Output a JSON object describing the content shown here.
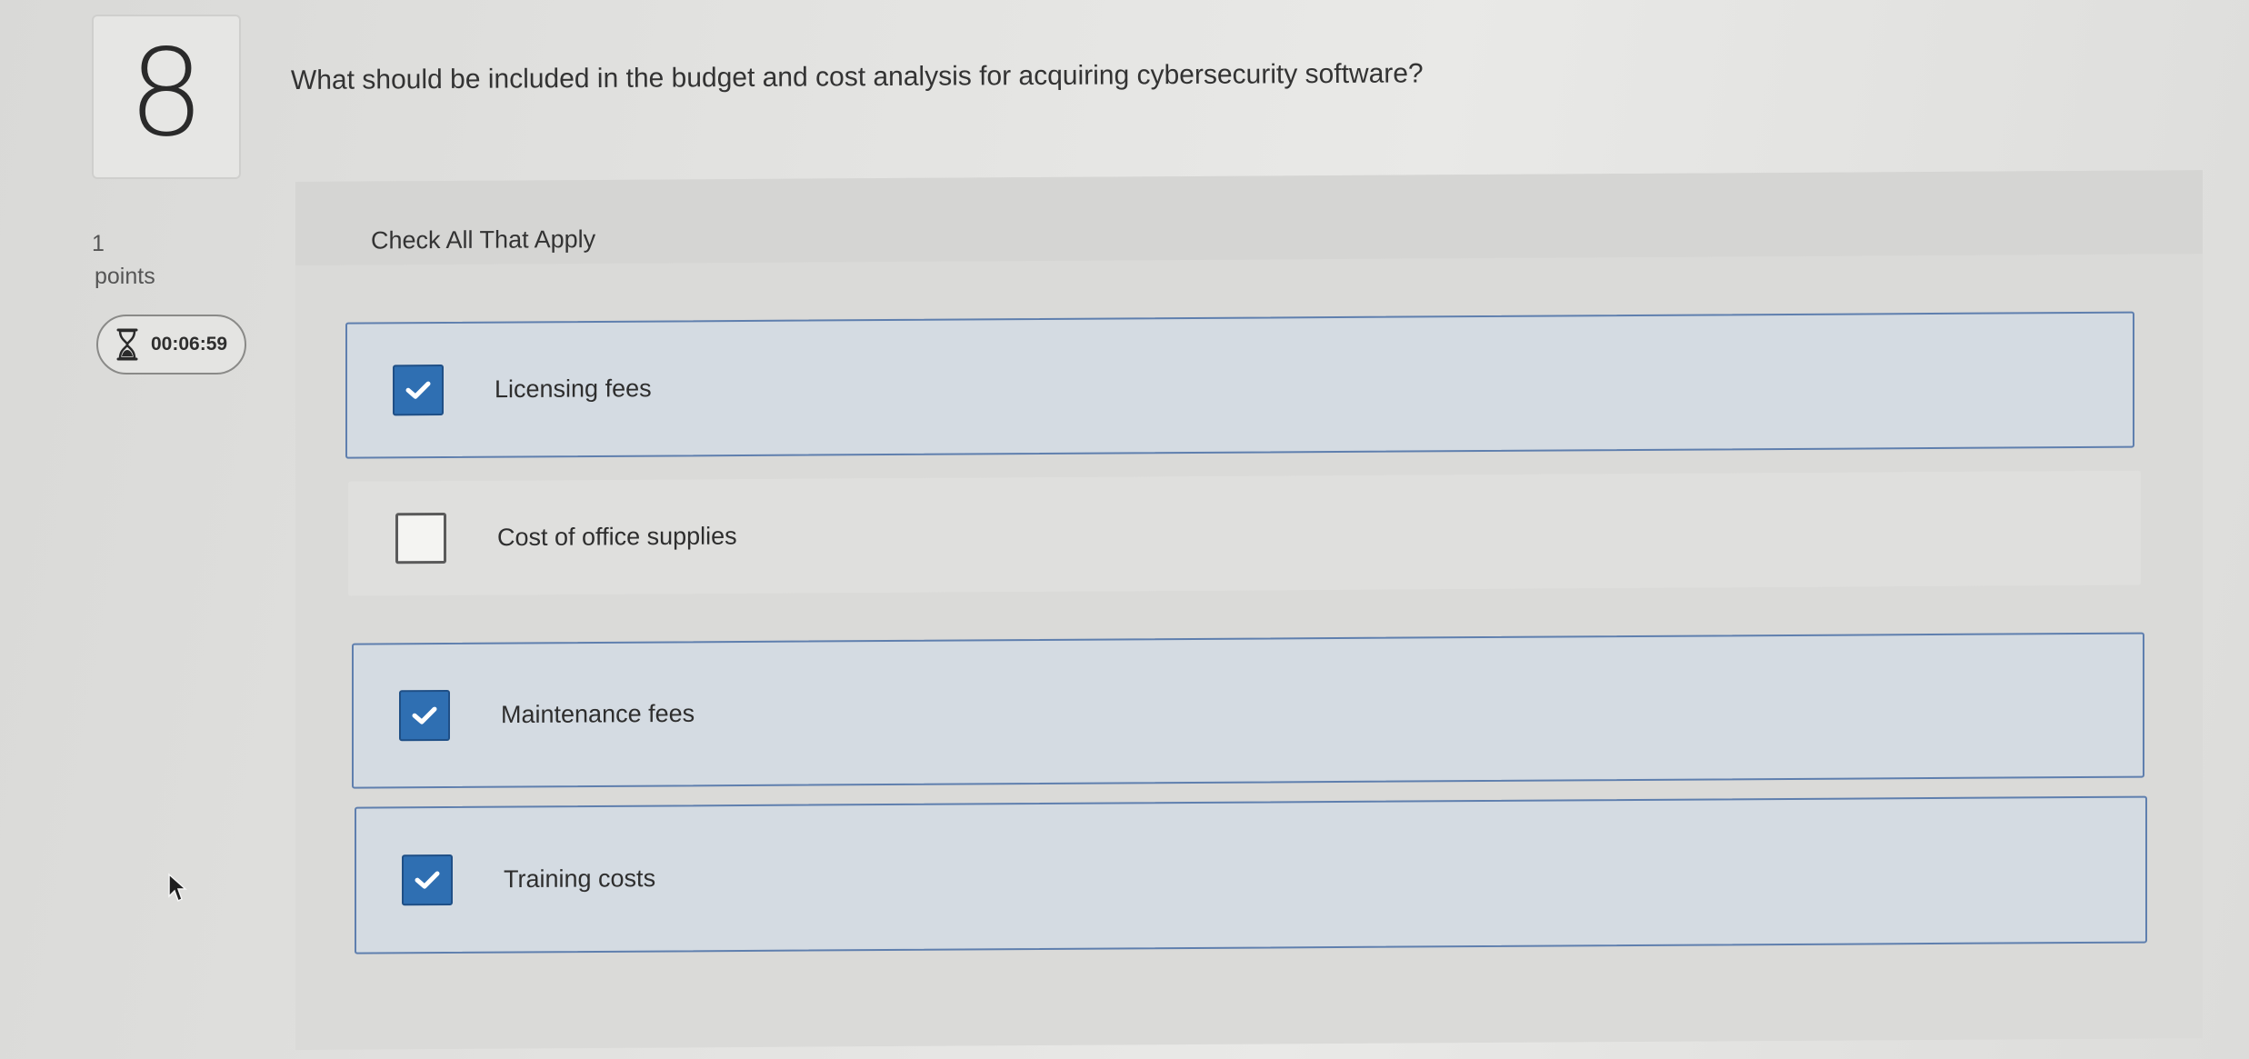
{
  "question": {
    "number": "8",
    "text": "What should be included in the budget and cost analysis for acquiring cybersecurity software?",
    "points_value": "1",
    "points_label": "points",
    "timer": "00:06:59",
    "timer_icon": "hourglass-icon",
    "instruction": "Check All That Apply"
  },
  "options": [
    {
      "label": "Licensing fees",
      "checked": true
    },
    {
      "label": "Cost of office supplies",
      "checked": false
    },
    {
      "label": "Maintenance fees",
      "checked": true
    },
    {
      "label": "Training costs",
      "checked": true
    }
  ],
  "colors": {
    "accent": "#2f6fb2",
    "selected_border": "#5f7fae",
    "selected_bg": "#d4dbe2"
  }
}
